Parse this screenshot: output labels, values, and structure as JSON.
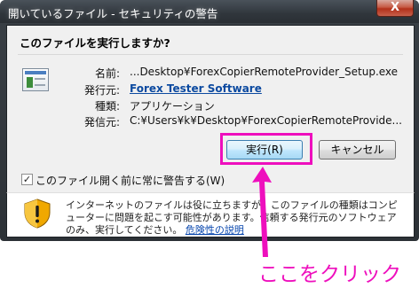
{
  "window": {
    "title": "開いているファイル - セキュリティの警告",
    "close_label": "X"
  },
  "dialog": {
    "heading": "このファイルを実行しますか?",
    "fields": [
      {
        "label": "名前:",
        "value": "...Desktop¥ForexCopierRemoteProvider_Setup.exe"
      },
      {
        "label": "発行元:",
        "value": "Forex Tester Software"
      },
      {
        "label": "種類:",
        "value": "アプリケーション"
      },
      {
        "label": "発信元:",
        "value": "C:¥Users¥k¥Desktop¥ForexCopierRemoteProvide..."
      }
    ],
    "run_button": "実行(R)",
    "cancel_button": "キャンセル",
    "checkbox_label": "このファイル開く前に常に警告する(W)",
    "checkbox_checked": true
  },
  "warning": {
    "text": "インターネットのファイルは役に立ちますが、このファイルの種類はコンピューターに問題を起こす可能性があります。信頼する発行元のソフトウェアのみ、実行してください。",
    "link": "危険性の説明",
    "icon": "shield-warning-icon"
  },
  "annotation": {
    "label": "ここをクリック",
    "color": "#ee0fbd"
  }
}
